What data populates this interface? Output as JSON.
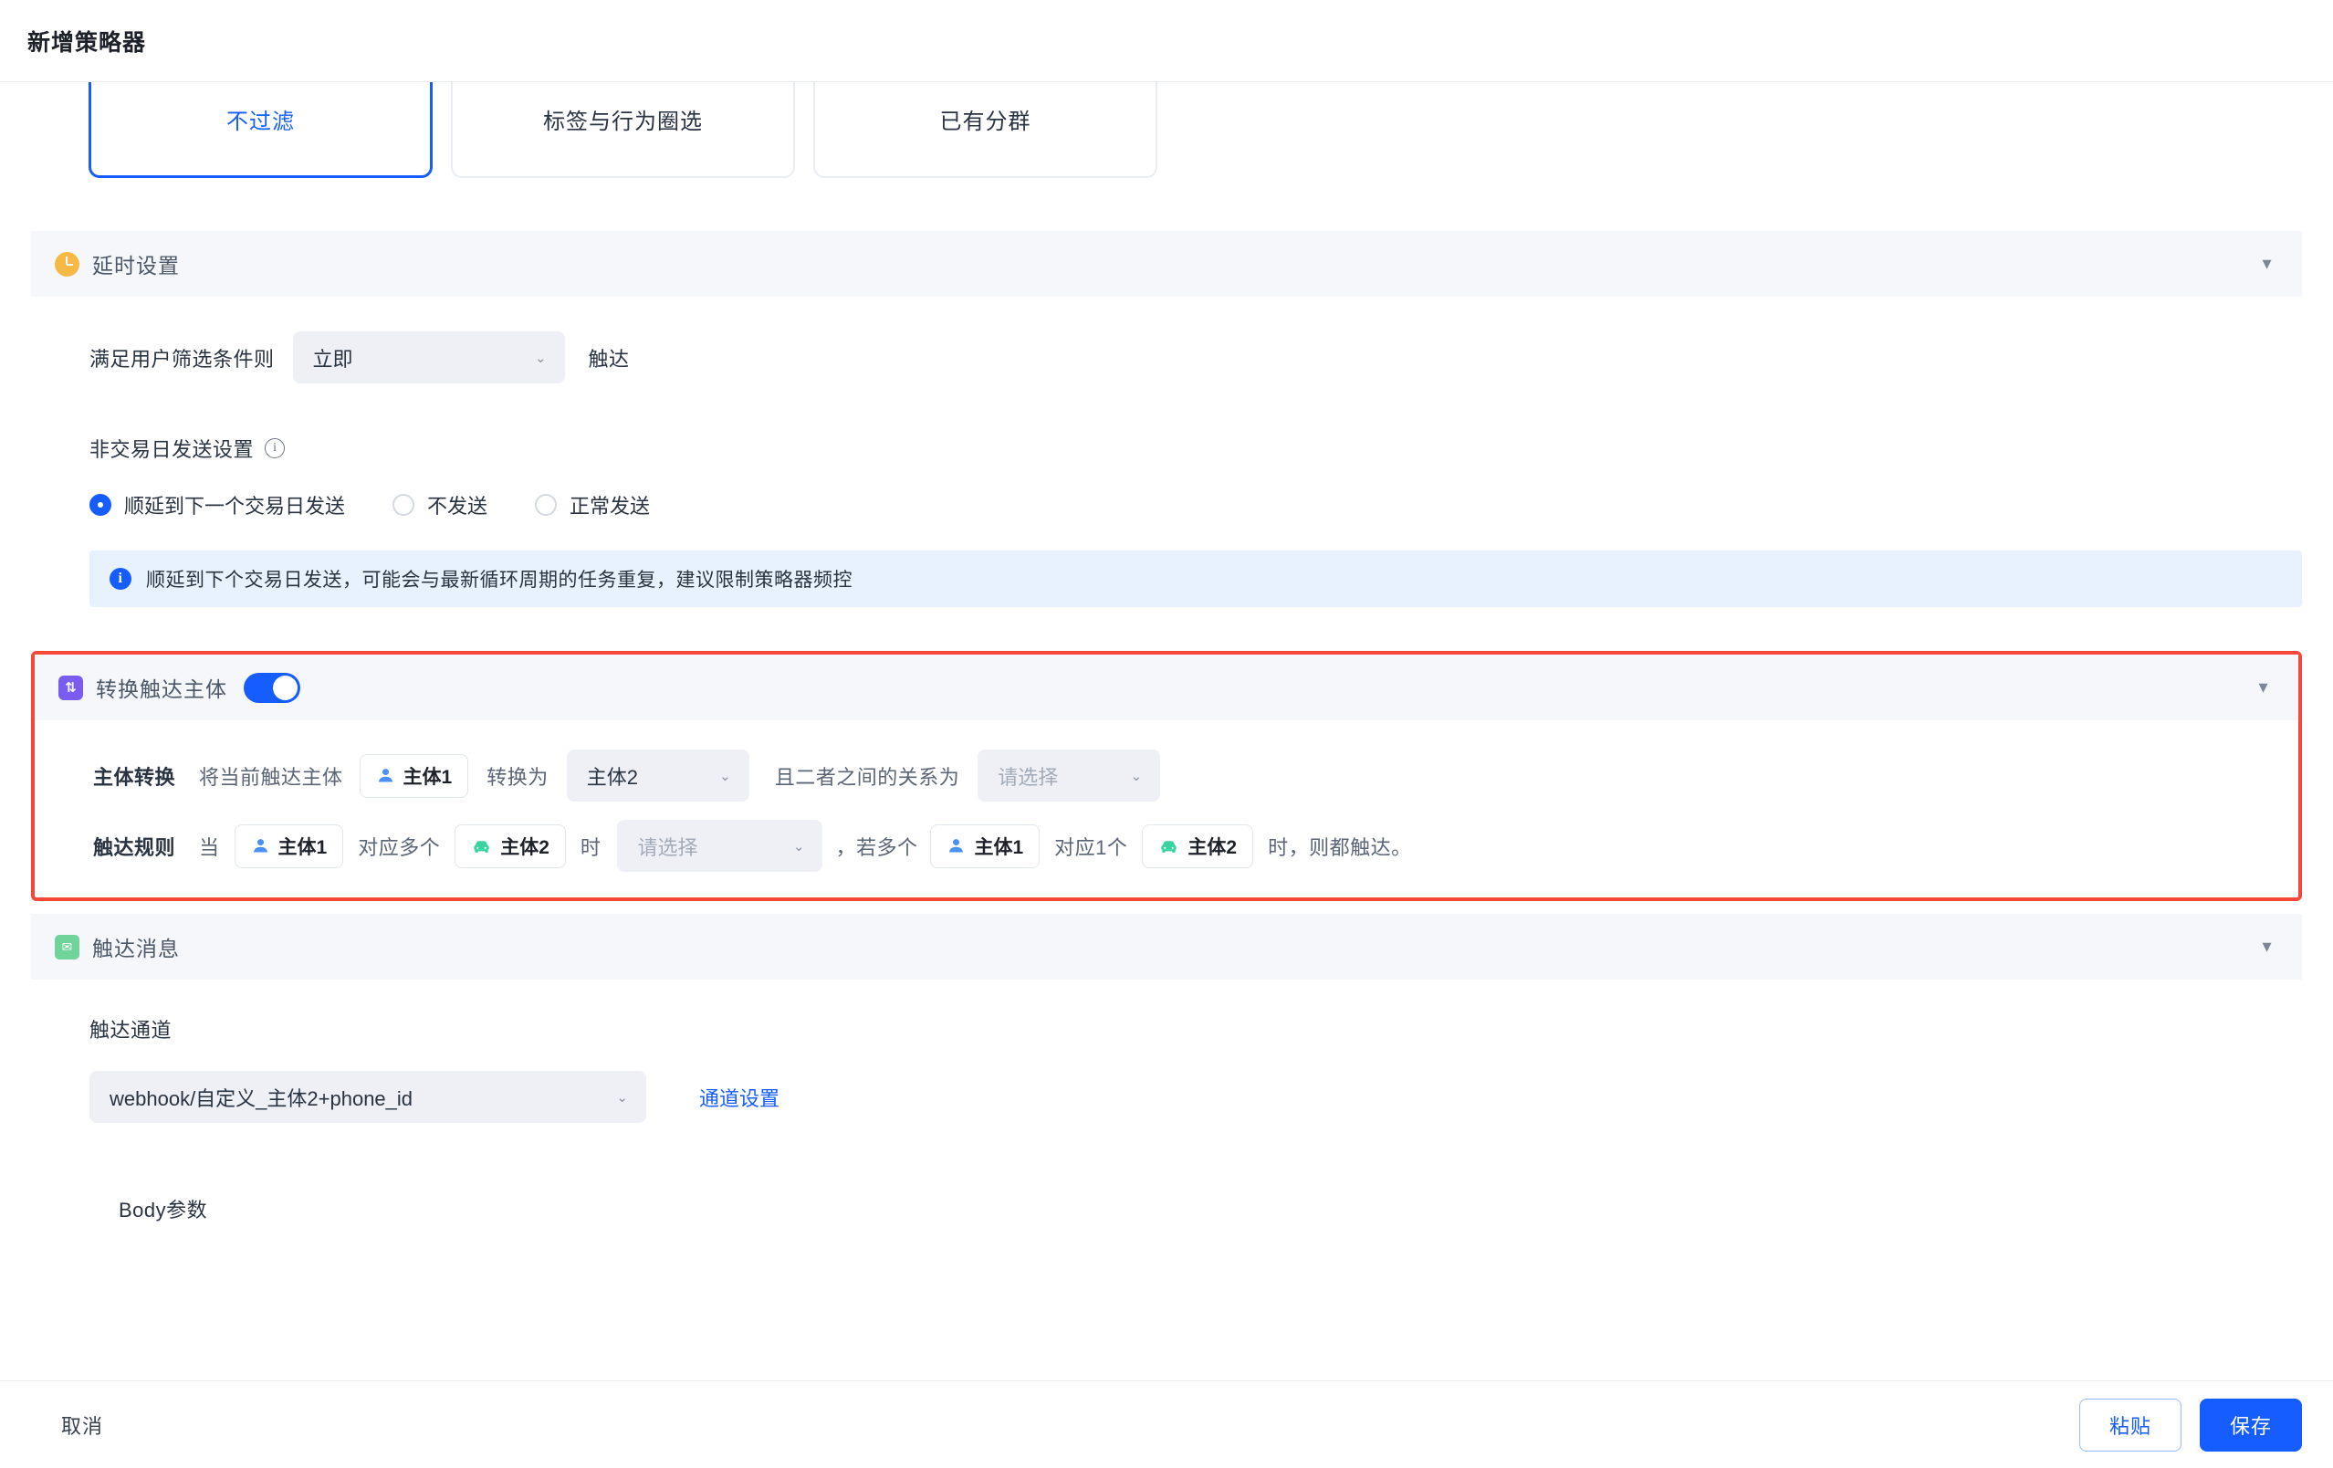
{
  "header": {
    "title": "新增策略器"
  },
  "audience_tabs": [
    {
      "label": "不过滤",
      "active": true
    },
    {
      "label": "标签与行为圈选",
      "active": false
    },
    {
      "label": "已有分群",
      "active": false
    }
  ],
  "delay_section": {
    "icon": "clock-icon",
    "title": "延时设置",
    "collapse_icon": "chevron-down-icon",
    "trigger_row": {
      "prefix_label": "满足用户筛选条件则",
      "select_value": "立即",
      "suffix_label": "触达"
    },
    "nontrading": {
      "label": "非交易日发送设置",
      "info_icon": "info-circle-icon",
      "options": [
        {
          "label": "顺延到下一个交易日发送",
          "checked": true
        },
        {
          "label": "不发送",
          "checked": false
        },
        {
          "label": "正常发送",
          "checked": false
        }
      ],
      "alert": {
        "icon": "info-icon",
        "text": "顺延到下个交易日发送，可能会与最新循环周期的任务重复，建议限制策略器频控"
      }
    }
  },
  "convert_section": {
    "icon": "swap-icon",
    "title": "转换触达主体",
    "toggle_on": true,
    "collapse_icon": "chevron-down-icon",
    "highlighted": true,
    "highlight_color": "#f5483b",
    "convert_row": {
      "label": "主体转换",
      "text1": "将当前触达主体",
      "chip1": {
        "label": "主体1",
        "icon": "person-icon",
        "color": "#4a90f7"
      },
      "text2": "转换为",
      "select_target": "主体2",
      "text3": "且二者之间的关系为",
      "select_relation_placeholder": "请选择"
    },
    "rule_row": {
      "label": "触达规则",
      "text1": "当",
      "chip1": {
        "label": "主体1",
        "icon": "person-icon",
        "color": "#4a90f7"
      },
      "text2": "对应多个",
      "chip2": {
        "label": "主体2",
        "icon": "car-icon",
        "color": "#3ad29f"
      },
      "text3": "时",
      "select_placeholder": "请选择",
      "text4": "，若多个",
      "chip3": {
        "label": "主体1",
        "icon": "person-icon",
        "color": "#4a90f7"
      },
      "text5": "对应1个",
      "chip4": {
        "label": "主体2",
        "icon": "car-icon",
        "color": "#3ad29f"
      },
      "text6": "时，则都触达。"
    }
  },
  "message_section": {
    "icon": "mail-icon",
    "title": "触达消息",
    "collapse_icon": "chevron-down-icon",
    "channel_label": "触达通道",
    "channel_value": "webhook/自定义_主体2+phone_id",
    "channel_settings_link": "通道设置",
    "body_params_label": "Body参数"
  },
  "footer": {
    "cancel_label": "取消",
    "paste_label": "粘贴",
    "save_label": "保存"
  },
  "colors": {
    "primary": "#165dff",
    "highlight": "#f5483b",
    "clock": "#f7b946",
    "swap": "#7a5cf0",
    "mail": "#6fd39a",
    "person": "#4a90f7",
    "car": "#3ad29f"
  }
}
